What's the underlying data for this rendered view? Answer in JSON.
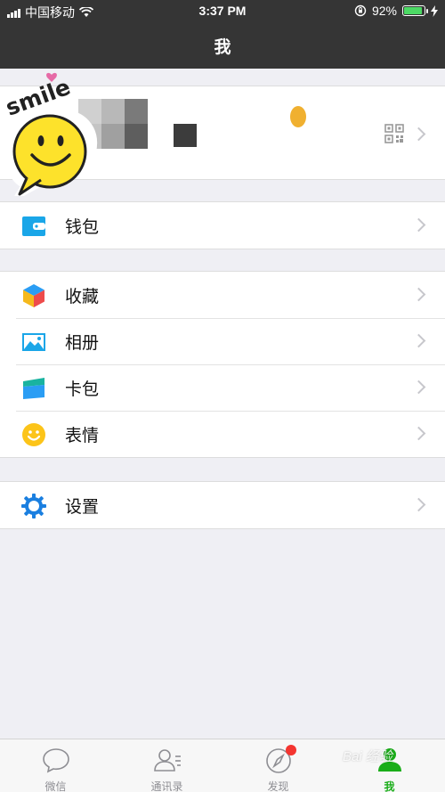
{
  "status_bar": {
    "carrier": "中国移动",
    "time": "3:37 PM",
    "battery": "92%",
    "battery_level": 0.92
  },
  "header": {
    "title": "我"
  },
  "sticker": {
    "text": "smile"
  },
  "menu": {
    "wallet": "钱包",
    "favorites": "收藏",
    "album": "相册",
    "cards": "卡包",
    "stickers": "表情",
    "settings": "设置"
  },
  "tabs": [
    {
      "label": "微信",
      "icon": "chat-icon"
    },
    {
      "label": "通讯录",
      "icon": "contacts-icon"
    },
    {
      "label": "发现",
      "icon": "compass-icon"
    },
    {
      "label": "我",
      "icon": "me-icon"
    }
  ],
  "watermark": {
    "text": "Bai 经验"
  },
  "colors": {
    "nav_bg": "#353535",
    "accent": "#1aad19",
    "badge": "#f43530",
    "wallet": "#1aa6e8"
  }
}
